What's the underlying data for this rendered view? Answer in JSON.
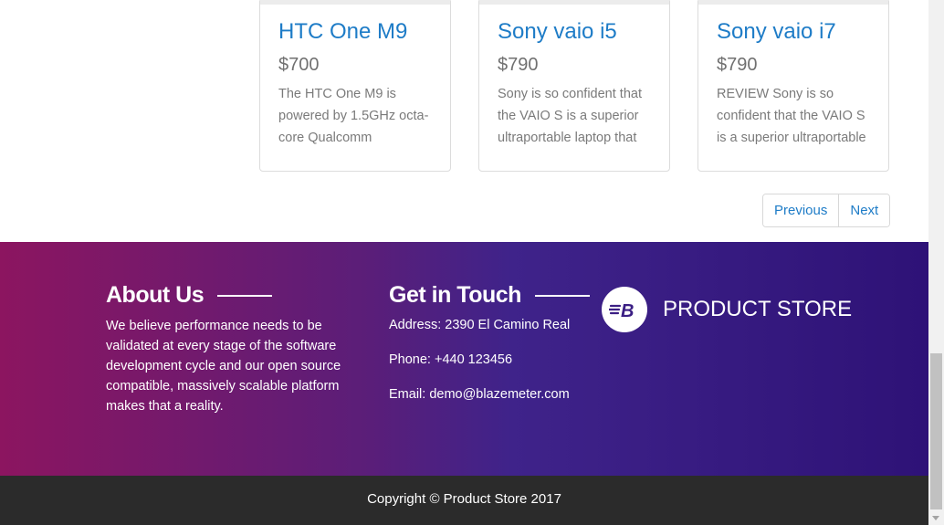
{
  "products": [
    {
      "title": "HTC One M9",
      "price": "$700",
      "description": "The HTC One M9 is powered by 1.5GHz octa-core Qualcomm"
    },
    {
      "title": "Sony vaio i5",
      "price": "$790",
      "description": "Sony is so confident that the VAIO S is a superior ultraportable laptop that"
    },
    {
      "title": "Sony vaio i7",
      "price": "$790",
      "description": "REVIEW Sony is so confident that the VAIO S is a superior ultraportable"
    }
  ],
  "pagination": {
    "previous": "Previous",
    "next": "Next"
  },
  "footer": {
    "about": {
      "heading": "About Us",
      "text": "We believe performance needs to be validated at every stage of the software development cycle and our open source compatible, massively scalable platform makes that a reality."
    },
    "contact": {
      "heading": "Get in Touch",
      "address": "Address: 2390 El Camino Real",
      "phone": "Phone: +440 123456",
      "email": "Email: demo@blazemeter.com"
    },
    "brand": {
      "logo_icon": "blazemeter-logo-icon",
      "name": "PRODUCT STORE"
    },
    "copyright": "Copyright © Product Store 2017"
  },
  "colors": {
    "link": "#1e7cc7",
    "footer_gradient_start": "#8c1560",
    "footer_gradient_end": "#2e1277",
    "copyright_bg": "#2b2b2b"
  }
}
